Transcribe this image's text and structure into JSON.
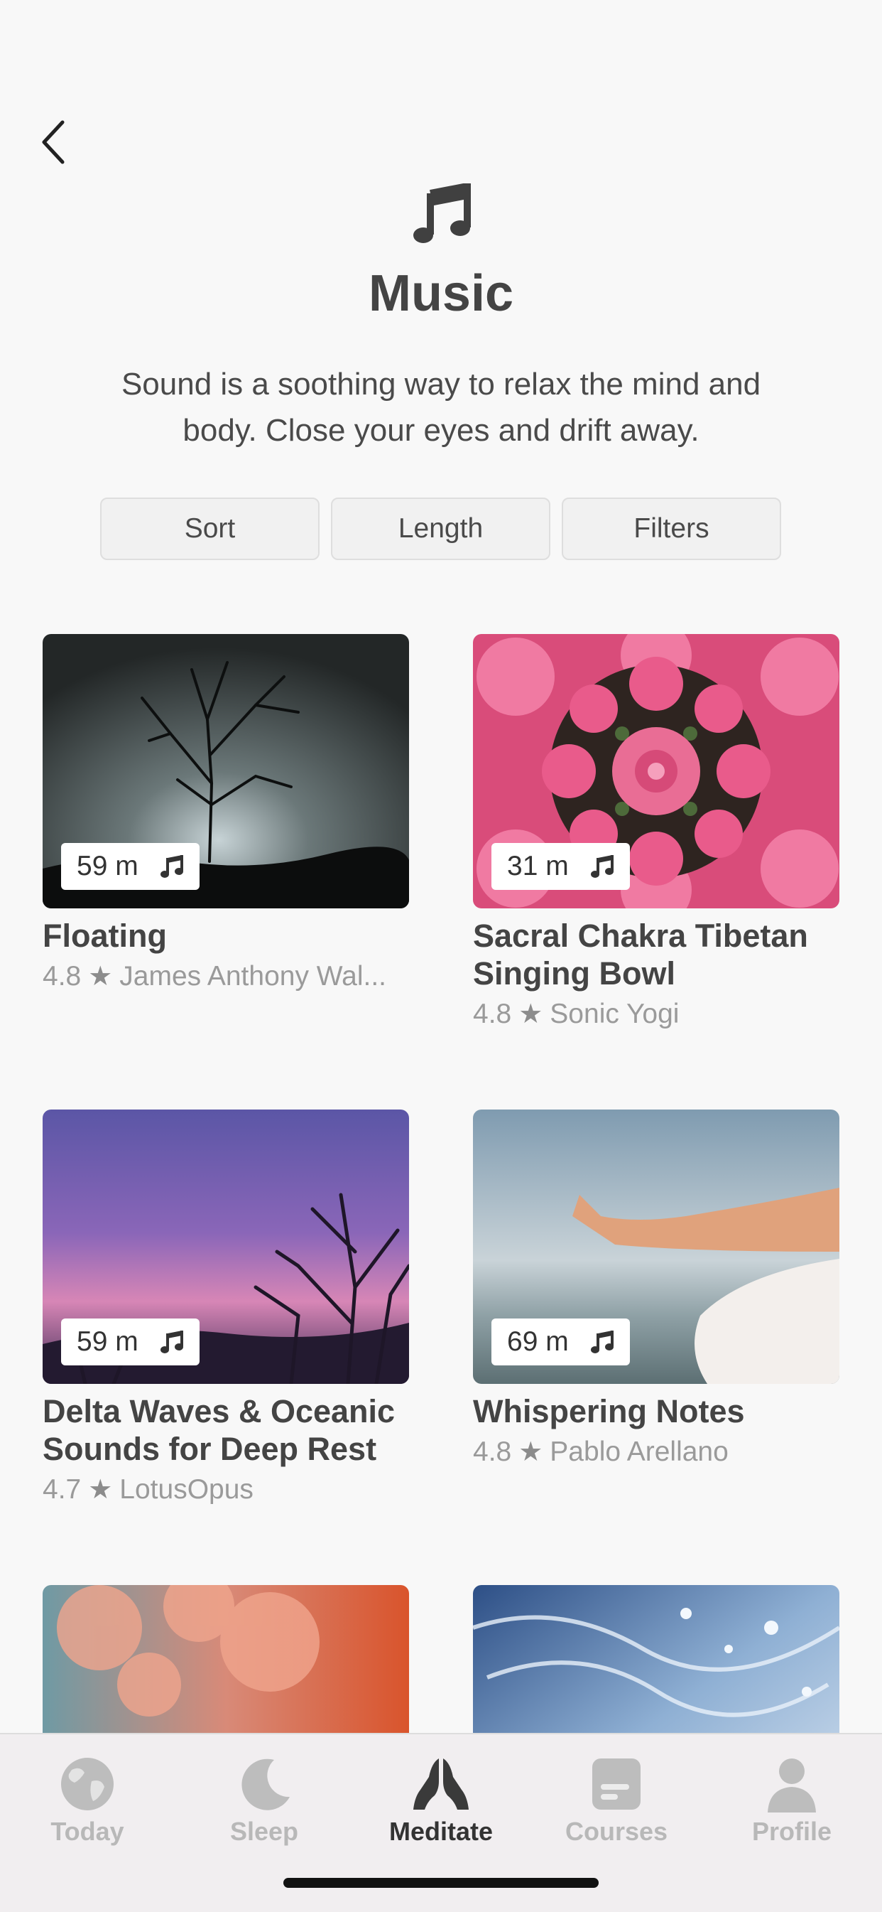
{
  "header": {
    "back_label": "Back",
    "icon": "music-note-icon",
    "title": "Music",
    "description": "Sound is a soothing way to relax the mind and body. Close your eyes and drift away."
  },
  "filters": {
    "sort": "Sort",
    "length": "Length",
    "filters": "Filters"
  },
  "cards": [
    {
      "title": "Floating",
      "duration": "59 m",
      "rating": "4.8",
      "author": "James Anthony Wal..."
    },
    {
      "title": "Sacral Chakra Tibetan Singing Bowl",
      "duration": "31 m",
      "rating": "4.8",
      "author": "Sonic Yogi"
    },
    {
      "title": "Delta Waves & Oceanic Sounds for Deep Rest",
      "duration": "59 m",
      "rating": "4.7",
      "author": "LotusOpus"
    },
    {
      "title": "Whispering Notes",
      "duration": "69 m",
      "rating": "4.8",
      "author": "Pablo Arellano"
    },
    {
      "title": "",
      "duration": "",
      "rating": "",
      "author": ""
    },
    {
      "title": "",
      "duration": "",
      "rating": "",
      "author": ""
    }
  ],
  "tabbar": {
    "items": [
      {
        "label": "Today",
        "icon": "globe-icon",
        "active": false
      },
      {
        "label": "Sleep",
        "icon": "moon-icon",
        "active": false
      },
      {
        "label": "Meditate",
        "icon": "praying-hands-icon",
        "active": true
      },
      {
        "label": "Courses",
        "icon": "course-card-icon",
        "active": false
      },
      {
        "label": "Profile",
        "icon": "person-icon",
        "active": false
      }
    ]
  },
  "colors": {
    "background": "#f8f8f8",
    "text_primary": "#444444",
    "text_secondary": "#9a9a9a",
    "tab_inactive": "#b8b8b8",
    "tab_active": "#333333"
  }
}
